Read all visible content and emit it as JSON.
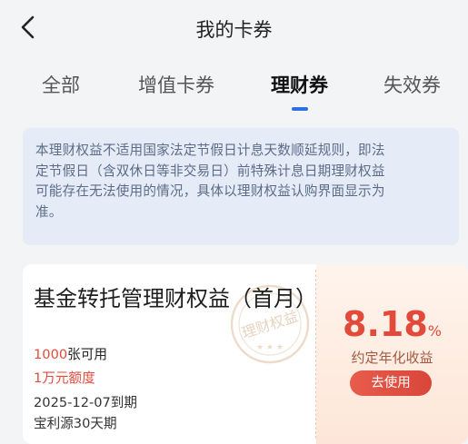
{
  "header": {
    "title": "我的卡券"
  },
  "tabs": [
    {
      "label": "全部",
      "active": false
    },
    {
      "label": "增值卡券",
      "active": false
    },
    {
      "label": "理财券",
      "active": true
    },
    {
      "label": "失效券",
      "active": false
    }
  ],
  "notice": {
    "lines": [
      "本理财权益不适用国家法定节假日计息天数顺延规则，即法",
      "定节假日（含双休日等非交易日）前特殊计息日期理财权益",
      "可能存在无法使用的情况，具体以理财权益认购界面显示为",
      "准。"
    ]
  },
  "coupon": {
    "title": "基金转托管理财权益（首月）",
    "stamp_text": "理财权益",
    "count_num": "1000",
    "count_suffix": "张可用",
    "quota": "1万元额度",
    "expire": "2025-12-07到期",
    "product": "宝利源30天期",
    "rate_value": "8.18",
    "rate_unit": "%",
    "rate_label": "约定年化收益",
    "use_button": "去使用"
  },
  "colors": {
    "accent_blue": "#2f6fe4",
    "coupon_red": "#e24a3b"
  }
}
